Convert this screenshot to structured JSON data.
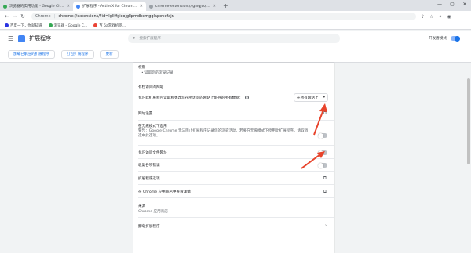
{
  "tabs": [
    {
      "label": "浏览器的实用功能 - Google Ch...",
      "color": "#34a853",
      "active": false
    },
    {
      "label": "扩展程序 - ActiveX for Chrom...",
      "color": "#4285f4",
      "active": true
    },
    {
      "label": "chrome-extension://lgllfgjcoj...",
      "color": "#9aa0a6",
      "active": false
    }
  ],
  "window": {
    "minimize": "—",
    "maximize": "▢",
    "close": "✕",
    "new_tab": "+"
  },
  "omnibox": {
    "scheme": "Chrome",
    "url": "chrome://extensions/?id=lgllffgicojgllpmdbemgglaponefajn"
  },
  "bookmarks": [
    {
      "label": "百度一下，你就知道",
      "color": "#2932e1"
    },
    {
      "label": "浏览器 - Google C...",
      "color": "#34a853"
    },
    {
      "label": "百 5a游戏机网…",
      "color": "#ea4335"
    }
  ],
  "header": {
    "title": "扩展程序",
    "search_placeholder": "搜索扩展程序",
    "dev_mode_label": "开发者模式"
  },
  "dev_toolbar": {
    "load_unpacked": "加载已解压的扩展程序",
    "pack": "打包扩展程序",
    "update": "更新"
  },
  "details": {
    "permissions_title": "权限",
    "permissions_item": "• 读取您的浏览记录",
    "site_access_title": "有权访问的网站",
    "site_access_desc": "允许此扩展程序读取和更改您在所访问的网站上留存的所有数据：",
    "site_access_help": "?",
    "site_access_value": "在所有网站上",
    "site_settings": "网站设置",
    "incognito_title": "在无痕模式下启用",
    "incognito_desc": "警告：Google Chrome 无法阻止扩展程序记录您的浏览活动。若要在无痕模式下停用此扩展程序，请取消选中此选项。",
    "file_urls": "允许访问文件网址",
    "collect_errors": "收集各项错误",
    "ext_options": "扩展程序选项",
    "view_in_store": "在 Chrome 应用商店中查看详情",
    "source_title": "来源",
    "source_value": "Chrome 应用商店",
    "remove": "卸载扩展程序"
  },
  "icons": {
    "back": "back-icon",
    "forward": "forward-icon",
    "reload": "reload-icon",
    "open_external": "open-in-new-icon"
  },
  "colors": {
    "accent": "#1a73e8",
    "annotation": "#e8442c"
  }
}
